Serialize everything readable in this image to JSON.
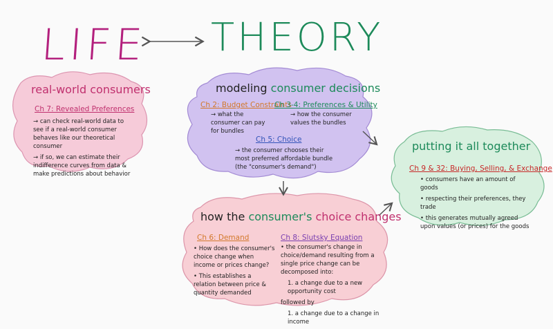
{
  "header": {
    "left_title": "LIFE",
    "right_title": "THEORY"
  },
  "colors": {
    "life": "#b3207d",
    "theory": "#1d8a5a",
    "real_world_cloud": "#f6c7d6",
    "modeling_cloud": "#cdbdf0",
    "together_cloud": "#d5f0dd",
    "changes_cloud": "#f8cbd2"
  },
  "real_world": {
    "title": "real-world consumers",
    "chapter": "Ch 7: Revealed Preferences",
    "bullet1": "→ can check real-world data to see if a real-world consumer behaves like our theoretical consumer",
    "bullet2": "→ if so, we can estimate their indifference curves from data & make predictions about behavior"
  },
  "modeling": {
    "title_a": "modeling ",
    "title_b": "consumer decisions",
    "ch2": "Ch 2: Budget Constraints",
    "ch34": "Ch 3-4: Preferences & Utility",
    "ch2_text": "→ what the consumer can pay for bundles",
    "ch34_text": "→ how the consumer values the bundles",
    "ch5": "Ch 5: Choice",
    "ch5_text": "→ the consumer chooses their most preferred affordable bundle (the \"consumer's demand\")"
  },
  "together": {
    "title": "putting it all together",
    "chapter": "Ch 9 & 32: Buying, Selling, & Exchange",
    "bullet1": "• consumers have an amount of goods",
    "bullet2": "• respecting their preferences, they trade",
    "bullet3": "• this generates mutually agreed upon values (or prices) for the goods"
  },
  "changes": {
    "title_a": "how the ",
    "title_b": "consumer's ",
    "title_c": "choice changes",
    "ch6": "Ch 6: Demand",
    "ch6_b1": "• How does the consumer's choice change when income or prices change?",
    "ch6_b2": "• This establishes a relation between price & quantity demanded",
    "ch8": "Ch 8: Slutsky Equation",
    "ch8_b1": "• the consumer's change in choice/demand resulting from a single price change can be decomposed into:",
    "ch8_i1": "1. a change due to a new opportunity cost",
    "ch8_follow": "followed by",
    "ch8_i2": "1. a change due to a change in income"
  }
}
